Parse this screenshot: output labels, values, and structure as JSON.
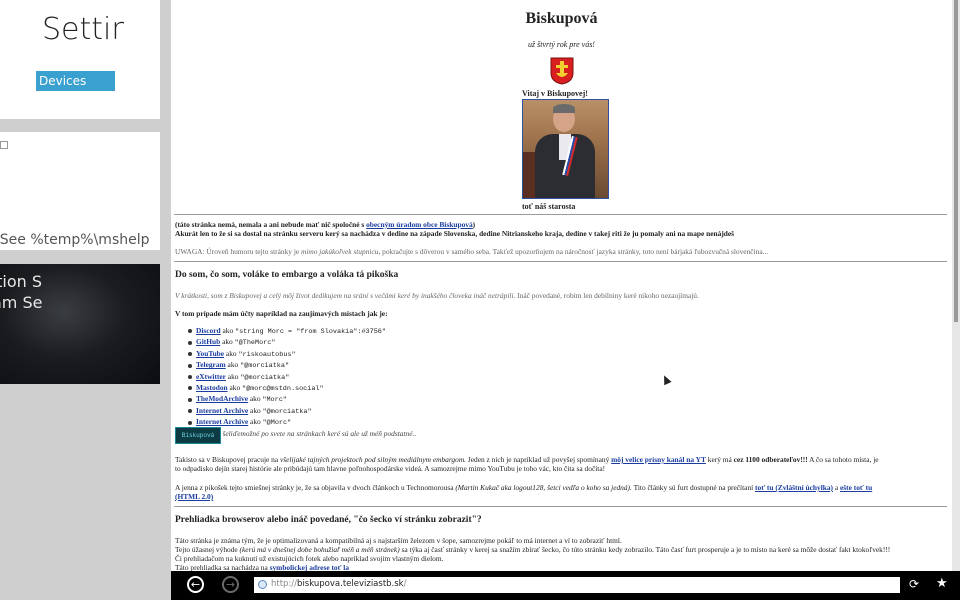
{
  "tiles": {
    "settings_title": "Setting",
    "devices_label": "Devices",
    "help_text": "d. See %temp%\\mshelp",
    "dark_line1": "ution S",
    "dark_line2": "am Se"
  },
  "page": {
    "title": "Biskupová",
    "subtitle": "už štvrtý rok pre vás!",
    "welcome": "Vitaj v Biskupovej!",
    "caption": "toť náš starosta",
    "intro1_a": "(táto stránka nemá, nemala a ani nebude mať nič spoločné s ",
    "intro1_link": "obecným úradom obce Biskupová",
    "intro1_b": ")",
    "intro2": "Akurát len to že si sa dostal na stránku serveru kerý sa nachádza v dedine na západe Slovenska, dedine Nitrianskeho kraja, dedine v takej riti že ju pomaly ani na mape nenájdeš",
    "warning_a": "UWAGA: Úroveň humoru tejto stránky je ",
    "warning_i": "mimo jakúkoľvek stupnicu",
    "warning_b": ", pokračujte s dôverou v samého seba. Takťež upozorňujem na náročnosť jazyka stránky, toto není bárjaká ľubozvučná slovenčina...",
    "h_whoami": "Do som, čo som, voláke to embargo a voláka tá pikoška",
    "p_whoami_i": "V krátkosti, som z Biskupovej a celý môj život dedikujem na srání s večámi keré by inakšého človeka ináč netrápili.",
    "p_whoami_b": " Ináč povedané, robím len debilniny keré nikoho nezaujímajú.",
    "h_accounts": "V tom prípade mám účty napríklad na zaujímavých místach jak je:",
    "accounts": [
      {
        "name": "Discord",
        "mid": " ako ",
        "value": "\"string Morc = \"from Slovakia\":#3756\""
      },
      {
        "name": "GitHub",
        "mid": " ako ",
        "value": "\"@TheMorc\""
      },
      {
        "name": "YouTube",
        "mid": " ako ",
        "value": "\"riskoautobus\""
      },
      {
        "name": "Telegram",
        "mid": " ako ",
        "value": "\"@morciatka\""
      },
      {
        "name": "eXtwitter",
        "mid": " ako ",
        "value": "\"@morciatka\""
      },
      {
        "name": "Mastodon",
        "mid": " ako ",
        "value": "\"@morc@mstdn.social\""
      },
      {
        "name": "TheModArchive",
        "mid": " ako ",
        "value": "\"Morc\""
      },
      {
        "name": "Internet Archive",
        "mid": " ako ",
        "value": "\"@morciatka\""
      },
      {
        "name": "Internet Archive",
        "mid": " ako ",
        "value": "\"@Morc\""
      }
    ],
    "accounts_note": "a ešte aj šeliďemožné po svete na stránkach keré sú ale už méň podstatné..",
    "button88": "Biskupová",
    "p_projects_a": "Takisto sa v Biskupovej pracuje na ",
    "p_projects_i": "všelijaké tajných projektoch pod silným mediálnym embargom.",
    "p_projects_b": " Jeden z nich je napríklad už povyšej spomínaný ",
    "p_projects_link": "môj velice prísny kanál na YT",
    "p_projects_c": " kerý má ",
    "p_projects_bold": "cez 1100 odberateľov!!!",
    "p_projects_d": " A čo sa tohoto místa, je",
    "p_projects_line2": "to odpadisko dejín starej histórie ale pribúdajú tam hlavne poľnohospodárske videá. A samozrejme mimo YouTubu je toho vác, kto čita sa dočíta!",
    "p_article_a": "A jenna z pikošek tejto smiešnej stránky je, že sa objavila v dvoch článkoch u Technomorousa ",
    "p_article_i": "(Martin Kukač aka logout128, šetci vedľa o koho sa jedná).",
    "p_article_b": " Tito články sú furt dostupné na prečítaní ",
    "p_article_link1": "toť tu (Zvláštní úchylka)",
    "p_article_c": " a ",
    "p_article_link2": "ešte toť tu",
    "p_article_link2b": "(HTML 2.0)",
    "h_browsers": "Prehliadka browserov alebo ináč povedané, \"čo šecko ví stránku zobrazit\"?",
    "p_br1": "Táto stránka je známa tým, že je optimalizovaná a kompatibilná aj s najstarším železom v šope, samozrejme pokáľ to má internet a ví to zobrazit' html.",
    "p_br2_a": "Tejto úžasnej výhode ",
    "p_br2_i": "(kerú má v dnešnej dobe bohužiaľ méň a méň stránek)",
    "p_br2_b": " sa týka aj časť stránky v kerej sa snažím zbírať šecko, čo túto stránku kedy zobrazilo. Táto časť furt prosperuje a je to místo na keré sa môže dostať fakt ktokoľvek!!!",
    "p_br3": "Či prehliadačom na kuknutí už existujúcich fotek alebo napríklad svojím vlastným dielom.",
    "p_br4_a": "Táto prehliadka sa nachádza na ",
    "p_br4_link": "symbolickej adrese toť la"
  },
  "browser": {
    "back_icon": "←",
    "forward_icon": "→",
    "url_prefix": "http://",
    "url_domain": "biskupova.televiziastb.sk",
    "url_suffix": "/",
    "refresh_icon": "⟳",
    "pin_icon": "★"
  }
}
